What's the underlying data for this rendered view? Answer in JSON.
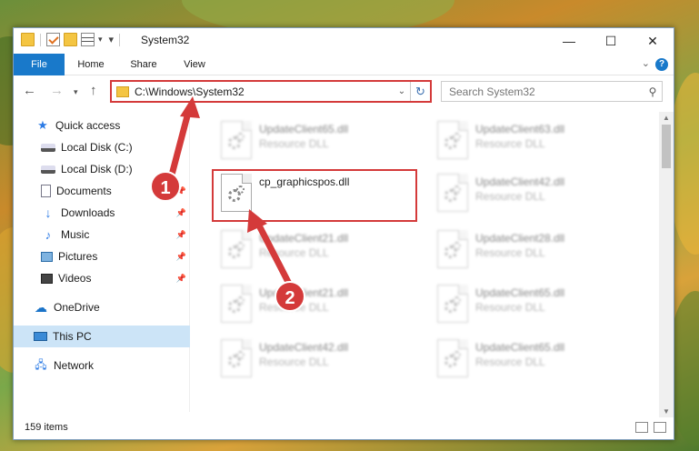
{
  "window": {
    "title": "System32",
    "controls": {
      "minimize": "—",
      "maximize": "☐",
      "close": "✕"
    }
  },
  "ribbon": {
    "tabs": [
      "File",
      "Home",
      "Share",
      "View"
    ],
    "help": "?"
  },
  "navbar": {
    "address_path": "C:\\Windows\\System32",
    "search_placeholder": "Search System32"
  },
  "sidebar": {
    "items": [
      {
        "label": "Quick access",
        "icon": "star-icon"
      },
      {
        "label": "Local Disk (C:)",
        "icon": "disk-icon"
      },
      {
        "label": "Local Disk (D:)",
        "icon": "disk-icon"
      },
      {
        "label": "Documents",
        "icon": "documents-icon",
        "pinned": true
      },
      {
        "label": "Downloads",
        "icon": "downloads-icon",
        "pinned": true
      },
      {
        "label": "Music",
        "icon": "music-icon",
        "pinned": true
      },
      {
        "label": "Pictures",
        "icon": "pictures-icon",
        "pinned": true
      },
      {
        "label": "Videos",
        "icon": "videos-icon",
        "pinned": true
      },
      {
        "label": "OneDrive",
        "icon": "onedrive-icon"
      },
      {
        "label": "This PC",
        "icon": "this-pc-icon",
        "selected": true
      },
      {
        "label": "Network",
        "icon": "network-icon"
      }
    ]
  },
  "files": [
    {
      "name": "UpdateClient65.dll",
      "type": "Resource DLL"
    },
    {
      "name": "UpdateClient63.dll",
      "type": "Resource DLL"
    },
    {
      "name": "cp_graphicspos.dll",
      "type": ""
    },
    {
      "name": "UpdateClient42.dll",
      "type": "Resource DLL"
    },
    {
      "name": "UpdateClient21.dll",
      "type": "Resource DLL"
    },
    {
      "name": "UpdateClient28.dll",
      "type": "Resource DLL"
    },
    {
      "name": "UpdateClient21.dll",
      "type": "Resource DLL"
    },
    {
      "name": "UpdateClient65.dll",
      "type": "Resource DLL"
    },
    {
      "name": "UpdateClient42.dll",
      "type": "Resource DLL"
    },
    {
      "name": "UpdateClient65.dll",
      "type": "Resource DLL"
    }
  ],
  "status": {
    "item_count": "159 items"
  },
  "callouts": {
    "one": "1",
    "two": "2"
  },
  "colors": {
    "accent": "#1979ca",
    "highlight": "#d43a3a",
    "selected": "#cce4f7"
  }
}
